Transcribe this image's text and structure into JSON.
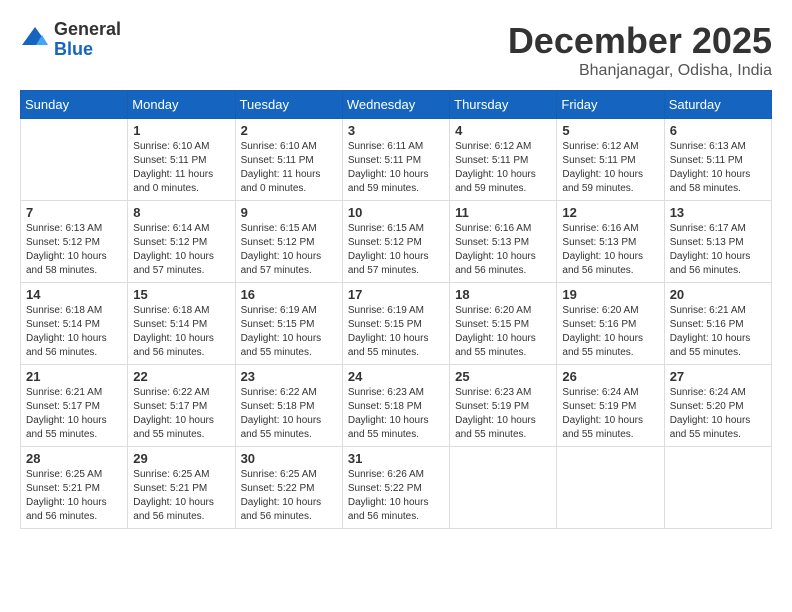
{
  "logo": {
    "general": "General",
    "blue": "Blue"
  },
  "title": {
    "month": "December 2025",
    "location": "Bhanjanagar, Odisha, India"
  },
  "headers": [
    "Sunday",
    "Monday",
    "Tuesday",
    "Wednesday",
    "Thursday",
    "Friday",
    "Saturday"
  ],
  "weeks": [
    [
      {
        "day": "",
        "info": ""
      },
      {
        "day": "1",
        "info": "Sunrise: 6:10 AM\nSunset: 5:11 PM\nDaylight: 11 hours\nand 0 minutes."
      },
      {
        "day": "2",
        "info": "Sunrise: 6:10 AM\nSunset: 5:11 PM\nDaylight: 11 hours\nand 0 minutes."
      },
      {
        "day": "3",
        "info": "Sunrise: 6:11 AM\nSunset: 5:11 PM\nDaylight: 10 hours\nand 59 minutes."
      },
      {
        "day": "4",
        "info": "Sunrise: 6:12 AM\nSunset: 5:11 PM\nDaylight: 10 hours\nand 59 minutes."
      },
      {
        "day": "5",
        "info": "Sunrise: 6:12 AM\nSunset: 5:11 PM\nDaylight: 10 hours\nand 59 minutes."
      },
      {
        "day": "6",
        "info": "Sunrise: 6:13 AM\nSunset: 5:11 PM\nDaylight: 10 hours\nand 58 minutes."
      }
    ],
    [
      {
        "day": "7",
        "info": "Sunrise: 6:13 AM\nSunset: 5:12 PM\nDaylight: 10 hours\nand 58 minutes."
      },
      {
        "day": "8",
        "info": "Sunrise: 6:14 AM\nSunset: 5:12 PM\nDaylight: 10 hours\nand 57 minutes."
      },
      {
        "day": "9",
        "info": "Sunrise: 6:15 AM\nSunset: 5:12 PM\nDaylight: 10 hours\nand 57 minutes."
      },
      {
        "day": "10",
        "info": "Sunrise: 6:15 AM\nSunset: 5:12 PM\nDaylight: 10 hours\nand 57 minutes."
      },
      {
        "day": "11",
        "info": "Sunrise: 6:16 AM\nSunset: 5:13 PM\nDaylight: 10 hours\nand 56 minutes."
      },
      {
        "day": "12",
        "info": "Sunrise: 6:16 AM\nSunset: 5:13 PM\nDaylight: 10 hours\nand 56 minutes."
      },
      {
        "day": "13",
        "info": "Sunrise: 6:17 AM\nSunset: 5:13 PM\nDaylight: 10 hours\nand 56 minutes."
      }
    ],
    [
      {
        "day": "14",
        "info": "Sunrise: 6:18 AM\nSunset: 5:14 PM\nDaylight: 10 hours\nand 56 minutes."
      },
      {
        "day": "15",
        "info": "Sunrise: 6:18 AM\nSunset: 5:14 PM\nDaylight: 10 hours\nand 56 minutes."
      },
      {
        "day": "16",
        "info": "Sunrise: 6:19 AM\nSunset: 5:15 PM\nDaylight: 10 hours\nand 55 minutes."
      },
      {
        "day": "17",
        "info": "Sunrise: 6:19 AM\nSunset: 5:15 PM\nDaylight: 10 hours\nand 55 minutes."
      },
      {
        "day": "18",
        "info": "Sunrise: 6:20 AM\nSunset: 5:15 PM\nDaylight: 10 hours\nand 55 minutes."
      },
      {
        "day": "19",
        "info": "Sunrise: 6:20 AM\nSunset: 5:16 PM\nDaylight: 10 hours\nand 55 minutes."
      },
      {
        "day": "20",
        "info": "Sunrise: 6:21 AM\nSunset: 5:16 PM\nDaylight: 10 hours\nand 55 minutes."
      }
    ],
    [
      {
        "day": "21",
        "info": "Sunrise: 6:21 AM\nSunset: 5:17 PM\nDaylight: 10 hours\nand 55 minutes."
      },
      {
        "day": "22",
        "info": "Sunrise: 6:22 AM\nSunset: 5:17 PM\nDaylight: 10 hours\nand 55 minutes."
      },
      {
        "day": "23",
        "info": "Sunrise: 6:22 AM\nSunset: 5:18 PM\nDaylight: 10 hours\nand 55 minutes."
      },
      {
        "day": "24",
        "info": "Sunrise: 6:23 AM\nSunset: 5:18 PM\nDaylight: 10 hours\nand 55 minutes."
      },
      {
        "day": "25",
        "info": "Sunrise: 6:23 AM\nSunset: 5:19 PM\nDaylight: 10 hours\nand 55 minutes."
      },
      {
        "day": "26",
        "info": "Sunrise: 6:24 AM\nSunset: 5:19 PM\nDaylight: 10 hours\nand 55 minutes."
      },
      {
        "day": "27",
        "info": "Sunrise: 6:24 AM\nSunset: 5:20 PM\nDaylight: 10 hours\nand 55 minutes."
      }
    ],
    [
      {
        "day": "28",
        "info": "Sunrise: 6:25 AM\nSunset: 5:21 PM\nDaylight: 10 hours\nand 56 minutes."
      },
      {
        "day": "29",
        "info": "Sunrise: 6:25 AM\nSunset: 5:21 PM\nDaylight: 10 hours\nand 56 minutes."
      },
      {
        "day": "30",
        "info": "Sunrise: 6:25 AM\nSunset: 5:22 PM\nDaylight: 10 hours\nand 56 minutes."
      },
      {
        "day": "31",
        "info": "Sunrise: 6:26 AM\nSunset: 5:22 PM\nDaylight: 10 hours\nand 56 minutes."
      },
      {
        "day": "",
        "info": ""
      },
      {
        "day": "",
        "info": ""
      },
      {
        "day": "",
        "info": ""
      }
    ]
  ]
}
